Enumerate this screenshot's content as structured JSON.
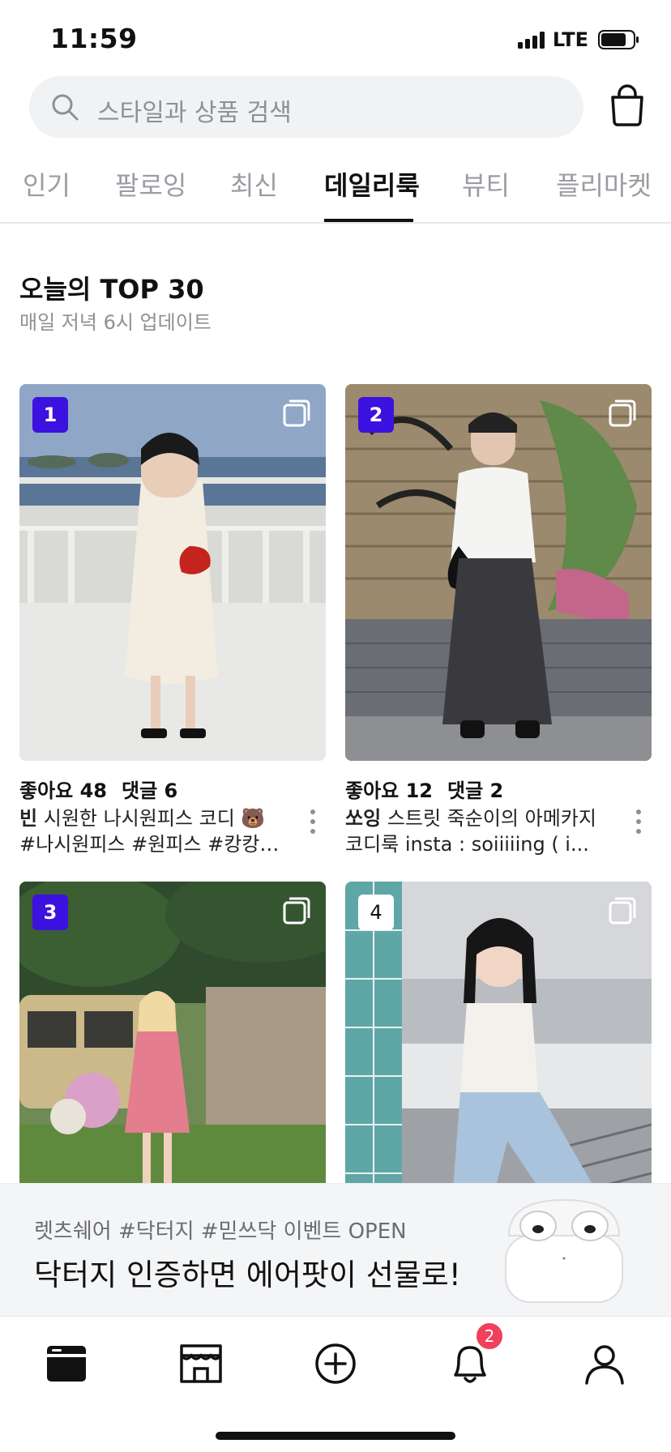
{
  "status_bar": {
    "time": "11:59",
    "network": "LTE",
    "icons": [
      "signal-icon",
      "battery-icon"
    ]
  },
  "search": {
    "placeholder": "스타일과 상품 검색",
    "icons": [
      "search-icon",
      "shopping-bag-icon"
    ]
  },
  "tabs": [
    {
      "label": "인기",
      "active": false
    },
    {
      "label": "팔로잉",
      "active": false
    },
    {
      "label": "최신",
      "active": false
    },
    {
      "label": "데일리룩",
      "active": true
    },
    {
      "label": "뷰티",
      "active": false
    },
    {
      "label": "플리마켓",
      "active": false
    }
  ],
  "section": {
    "title": "오늘의 TOP 30",
    "subtitle": "매일 저녁 6시 업데이트"
  },
  "posts": [
    {
      "rank": "1",
      "stats": {
        "likes": "좋아요 48",
        "comments": "댓글 6"
      },
      "author": "빈",
      "caption_line1": "시원한 나시원피스 코디 🐻",
      "caption_line2": "#나시원피스 #원피스 #캉캉…"
    },
    {
      "rank": "2",
      "stats": {
        "likes": "좋아요 12",
        "comments": "댓글 2"
      },
      "author": "쏘잉",
      "caption_line1": "스트릿 죽순이의 아메카지",
      "caption_line2": "코디룩 insta : soiiiiing ( i..."
    },
    {
      "rank": "3"
    },
    {
      "rank": "4"
    }
  ],
  "banner": {
    "subtitle": "렛츠쉐어 #닥터지 #믿쓰닥 이벤트 OPEN",
    "title": "닥터지 인증하면 에어팟이 선물로!",
    "product_icon": "airpods-case-image"
  },
  "bottom_nav": {
    "items": [
      "home-icon",
      "store-icon",
      "add-icon",
      "notification-icon",
      "profile-icon"
    ],
    "notification_count": "2"
  },
  "colors": {
    "accent": "#3b12e0",
    "badge": "#f0405a",
    "search_bg": "#f1f2f4",
    "inactive_tab": "#9a9ca2"
  }
}
